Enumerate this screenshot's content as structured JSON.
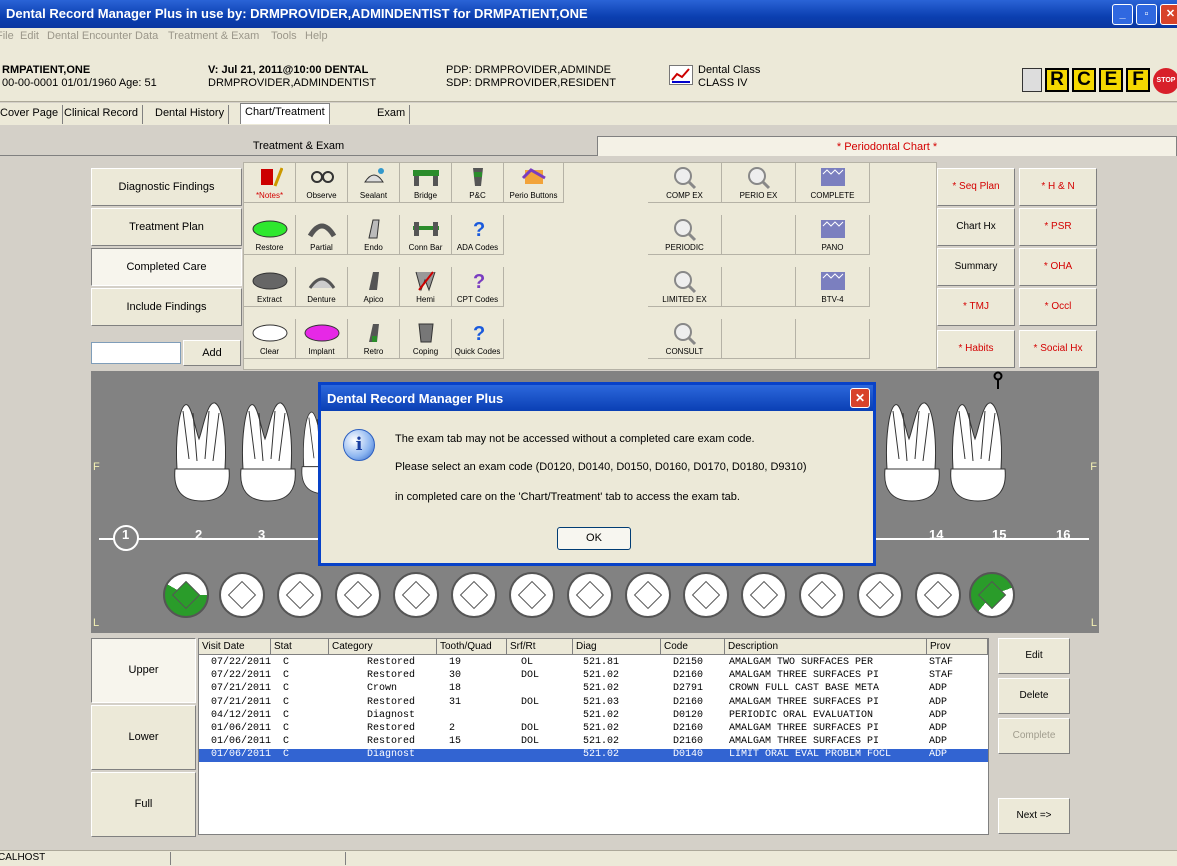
{
  "window": {
    "title": "Dental Record Manager Plus in use by: DRMPROVIDER,ADMINDENTIST for DRMPATIENT,ONE"
  },
  "menu": [
    "File",
    "Edit",
    "Dental Encounter Data",
    "Treatment & Exam",
    "Tools",
    "Help"
  ],
  "patient": {
    "name": "RMPATIENT,ONE",
    "id_line": "00-00-0001   01/01/1960  Age:  51",
    "visit": "V: Jul 21, 2011@10:00 DENTAL",
    "visit_provider": "DRMPROVIDER,ADMINDENTIST",
    "pdp": "PDP:  DRMPROVIDER,ADMINDE",
    "sdp": "SDP:  DRMPROVIDER,RESIDENT",
    "dental_class_label": "Dental Class",
    "dental_class_value": "CLASS IV",
    "badges": [
      "R",
      "C",
      "E",
      "F"
    ],
    "stop_label": "STOP"
  },
  "tabs": [
    "Cover Page",
    "Clinical Record",
    "Dental History",
    "Chart/Treatment",
    "Exam"
  ],
  "active_tab": "Chart/Treatment",
  "section": {
    "left": "Treatment & Exam",
    "right": "* Periodontal Chart *"
  },
  "side_buttons": [
    "Diagnostic Findings",
    "Treatment Plan",
    "Completed Care",
    "Include Findings"
  ],
  "add_label": "Add",
  "tools": [
    {
      "label": "*Notes*",
      "red": true
    },
    {
      "label": "Observe"
    },
    {
      "label": "Sealant"
    },
    {
      "label": "Bridge"
    },
    {
      "label": "P&C"
    },
    {
      "label": "Perio Buttons"
    },
    {
      "label": "Restore"
    },
    {
      "label": "Partial"
    },
    {
      "label": "Endo"
    },
    {
      "label": "Conn Bar"
    },
    {
      "label": "ADA Codes"
    },
    {
      "label": "Extract"
    },
    {
      "label": "Denture"
    },
    {
      "label": "Apico"
    },
    {
      "label": "Hemi"
    },
    {
      "label": "CPT Codes"
    },
    {
      "label": "Clear"
    },
    {
      "label": "Implant"
    },
    {
      "label": "Retro"
    },
    {
      "label": "Coping"
    },
    {
      "label": "Quick Codes"
    }
  ],
  "exam_tools": [
    "COMP EX",
    "PERIO EX",
    "COMPLETE",
    "PERIODIC",
    "PANO",
    "LIMITED EX",
    "BTV-4",
    "CONSULT"
  ],
  "right_buttons": [
    "* Seq Plan",
    "* H & N",
    "Chart Hx",
    "* PSR",
    "Summary",
    "* OHA",
    "* TMJ",
    "* Occl",
    "* Habits",
    "* Social Hx"
  ],
  "tooth_numbers": [
    "1",
    "2",
    "3",
    "14",
    "15",
    "16"
  ],
  "edge_labels": {
    "facial": "F",
    "lingual": "L"
  },
  "dialog": {
    "title": "Dental Record Manager Plus",
    "line1": "The exam tab may not be accessed without a completed care exam code.",
    "line2": "Please select an exam code (D0120, D0140, D0150, D0160, D0170, D0180, D9310)",
    "line3": "in completed care on the 'Chart/Treatment' tab to access the exam tab.",
    "ok": "OK"
  },
  "grid": {
    "columns": [
      "Visit Date",
      "Stat",
      "Category",
      "Tooth/Quad",
      "Srf/Rt",
      "Diag",
      "Code",
      "Description",
      "Prov"
    ],
    "rows": [
      [
        "07/22/2011",
        "C",
        "Restored",
        "19",
        "OL",
        "521.81",
        "D2150",
        "AMALGAM TWO SURFACES PER",
        "STAF"
      ],
      [
        "07/22/2011",
        "C",
        "Restored",
        "30",
        "DOL",
        "521.02",
        "D2160",
        "AMALGAM THREE SURFACES PI",
        "STAF"
      ],
      [
        "07/21/2011",
        "C",
        "Crown",
        "18",
        "",
        "521.02",
        "D2791",
        "CROWN FULL CAST BASE META",
        "ADP"
      ],
      [
        "07/21/2011",
        "C",
        "Restored",
        "31",
        "DOL",
        "521.03",
        "D2160",
        "AMALGAM THREE SURFACES PI",
        "ADP"
      ],
      [
        "04/12/2011",
        "C",
        "Diagnost",
        "",
        "",
        "521.02",
        "D0120",
        "PERIODIC ORAL EVALUATION",
        "ADP"
      ],
      [
        "01/06/2011",
        "C",
        "Restored",
        "2",
        "DOL",
        "521.02",
        "D2160",
        "AMALGAM THREE SURFACES PI",
        "ADP"
      ],
      [
        "01/06/2011",
        "C",
        "Restored",
        "15",
        "DOL",
        "521.02",
        "D2160",
        "AMALGAM THREE SURFACES PI",
        "ADP"
      ],
      [
        "01/06/2011",
        "C",
        "Diagnost",
        "",
        "",
        "521.02",
        "D0140",
        "LIMIT ORAL EVAL PROBLM FOCL",
        "ADP"
      ]
    ],
    "selected_row": 7
  },
  "arch_buttons": [
    "Upper",
    "Lower",
    "Full"
  ],
  "grid_buttons": [
    "Edit",
    "Delete",
    "Complete",
    "Next =>"
  ],
  "status": {
    "host": "CALHOST"
  }
}
